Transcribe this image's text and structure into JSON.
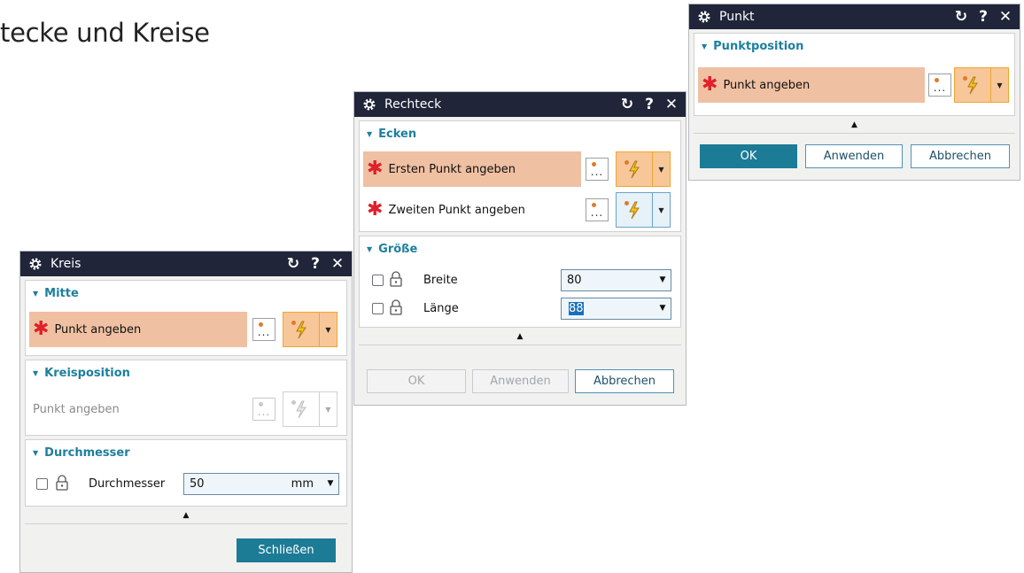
{
  "page": {
    "heading": "tecke und Kreise"
  },
  "colors": {
    "titlebar": "#20253a",
    "section_title": "#1d7f9e",
    "active_selection": "#efc0a2",
    "required_star": "#e0202a",
    "primary_button": "#1c7b95"
  },
  "title_controls": {
    "reset": "↻",
    "help": "?",
    "close": "✕"
  },
  "kreis": {
    "title": "Kreis",
    "mitte": {
      "header": "Mitte",
      "row": {
        "label": "Punkt angeben"
      }
    },
    "kreisposition": {
      "header": "Kreisposition",
      "row": {
        "label": "Punkt angeben"
      }
    },
    "durchmesser": {
      "header": "Durchmesser",
      "field_label": "Durchmesser",
      "value": "50",
      "unit": "mm"
    },
    "buttons": {
      "close": "Schließen"
    }
  },
  "rechteck": {
    "title": "Rechteck",
    "ecken": {
      "header": "Ecken",
      "row1": {
        "label": "Ersten Punkt angeben"
      },
      "row2": {
        "label": "Zweiten Punkt angeben"
      }
    },
    "groesse": {
      "header": "Größe",
      "breite_label": "Breite",
      "breite_value": "80",
      "laenge_label": "Länge",
      "laenge_value": "88"
    },
    "buttons": {
      "ok": "OK",
      "apply": "Anwenden",
      "cancel": "Abbrechen"
    }
  },
  "punkt": {
    "title": "Punkt",
    "punktposition": {
      "header": "Punktposition",
      "row": {
        "label": "Punkt angeben"
      }
    },
    "buttons": {
      "ok": "OK",
      "apply": "Anwenden",
      "cancel": "Abbrechen"
    }
  },
  "glyphs": {
    "dots": "...",
    "star": "✱",
    "triangle_down": "▼",
    "triangle_up": "▲",
    "dropdown": "▼"
  }
}
